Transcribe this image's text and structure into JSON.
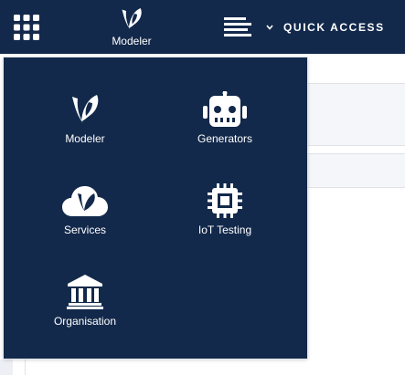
{
  "header": {
    "brand_label": "Modeler",
    "quick_access_label": "QUICK ACCESS"
  },
  "apps": [
    {
      "label": "Modeler",
      "icon": "modeler-logo-icon"
    },
    {
      "label": "Generators",
      "icon": "robot-icon"
    },
    {
      "label": "Services",
      "icon": "cloud-logo-icon"
    },
    {
      "label": "IoT Testing",
      "icon": "chip-icon"
    },
    {
      "label": "Organisation",
      "icon": "institution-icon"
    }
  ],
  "colors": {
    "navy": "#13294b",
    "white": "#ffffff",
    "light_border": "#dfe3e8"
  }
}
